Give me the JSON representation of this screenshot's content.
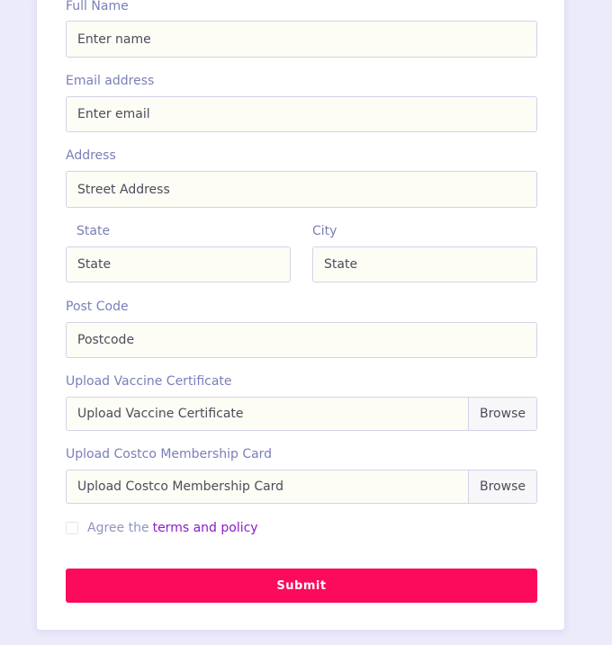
{
  "form": {
    "full_name": {
      "label": "Full Name",
      "placeholder": "Enter name"
    },
    "email": {
      "label": "Email address",
      "placeholder": "Enter email"
    },
    "address": {
      "label": "Address",
      "placeholder": "Street Address"
    },
    "state": {
      "label": "State",
      "placeholder": "State"
    },
    "city": {
      "label": "City",
      "placeholder": "State"
    },
    "postcode": {
      "label": "Post Code",
      "placeholder": "Postcode"
    },
    "vaccine_upload": {
      "label": "Upload Vaccine Certificate",
      "placeholder": "Upload Vaccine Certificate",
      "browse_label": "Browse"
    },
    "costco_upload": {
      "label": "Upload Costco Membership Card",
      "placeholder": "Upload Costco Membership Card",
      "browse_label": "Browse"
    },
    "agree": {
      "prefix": "Agree the",
      "link": "terms and policy",
      "checked": false
    },
    "submit_label": "Submit"
  },
  "colors": {
    "background": "#ecebfa",
    "label": "#7a7fb8",
    "link": "#8a1cc8",
    "submit": "#fc0a5b"
  }
}
